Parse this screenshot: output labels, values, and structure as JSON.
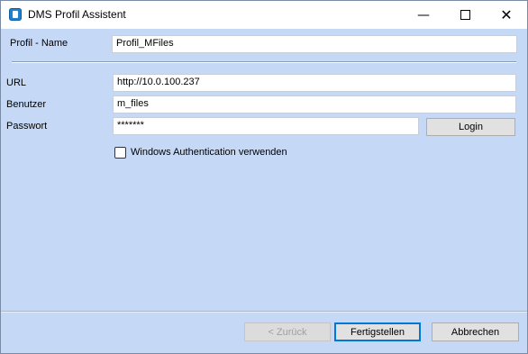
{
  "window": {
    "title": "DMS Profil Assistent",
    "minimize_icon": "minimize-icon",
    "maximize_icon": "maximize-icon",
    "close_icon": "close-icon"
  },
  "profile": {
    "label": "Profil - Name",
    "value": "Profil_MFiles"
  },
  "url": {
    "label": "URL",
    "value": "http://10.0.100.237"
  },
  "user": {
    "label": "Benutzer",
    "value": "m_files"
  },
  "password": {
    "label": "Passwort",
    "value": "*******",
    "login_label": "Login"
  },
  "windows_auth": {
    "label": "Windows Authentication verwenden",
    "checked": false
  },
  "footer": {
    "back_label": "< Zurück",
    "finish_label": "Fertigstellen",
    "cancel_label": "Abbrechen"
  },
  "colors": {
    "background": "#c5d9f6",
    "titlebar": "#ffffff",
    "accent": "#0078d7"
  }
}
